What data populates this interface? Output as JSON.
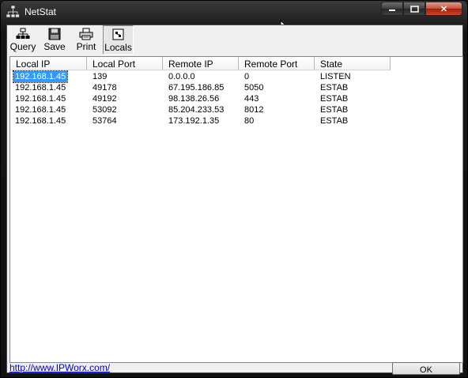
{
  "window": {
    "title": "NetStat",
    "close_symbol": "✕",
    "title_icon": "network-icon"
  },
  "toolbar": {
    "buttons": [
      {
        "label": "Query",
        "icon": "query-icon"
      },
      {
        "label": "Save",
        "icon": "floppy-disk-icon"
      },
      {
        "label": "Print",
        "icon": "printer-icon"
      },
      {
        "label": "Locals",
        "icon": "locals-icon",
        "pressed": true
      }
    ]
  },
  "table": {
    "columns": [
      "Local IP",
      "Local Port",
      "Remote IP",
      "Remote Port",
      "State"
    ],
    "rows": [
      [
        "192.168.1.45",
        "139",
        "0.0.0.0",
        "0",
        "LISTEN"
      ],
      [
        "192.168.1.45",
        "49178",
        "67.195.186.85",
        "5050",
        "ESTAB"
      ],
      [
        "192.168.1.45",
        "49192",
        "98.138.26.56",
        "443",
        "ESTAB"
      ],
      [
        "192.168.1.45",
        "53092",
        "85.204.233.53",
        "8012",
        "ESTAB"
      ],
      [
        "192.168.1.45",
        "53764",
        "173.192.1.35",
        "80",
        "ESTAB"
      ]
    ]
  },
  "status": {
    "link": "http://www.IPWorx.com/",
    "ok_label": "OK"
  },
  "colors": {
    "selection": "#3399ff",
    "link": "#0000cc",
    "close_button": "#c2503b"
  }
}
